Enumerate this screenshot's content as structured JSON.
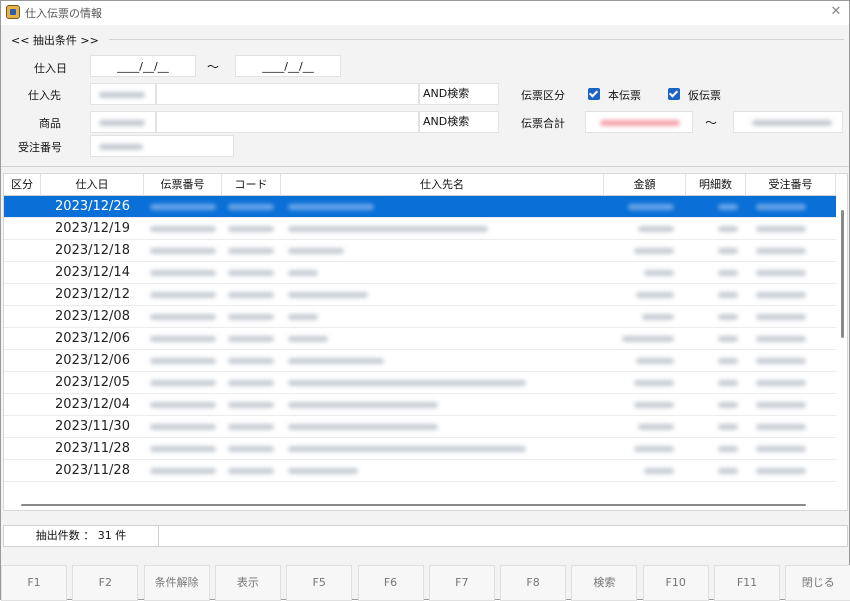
{
  "window": {
    "title": "仕入伝票の情報"
  },
  "conditions": {
    "header": "<< 抽出条件 >>",
    "date_label": "仕入日",
    "date_from": "____/__/__",
    "date_tilde": "～",
    "date_to": "____/__/__",
    "supplier_label": "仕入先",
    "supplier_and": "AND検索",
    "product_label": "商品",
    "product_and": "AND検索",
    "order_label": "受注番号",
    "slip_type_label": "伝票区分",
    "slip_main": "本伝票",
    "slip_temp": "仮伝票",
    "total_label": "伝票合計",
    "total_tilde": "～"
  },
  "grid": {
    "columns": [
      "区分",
      "仕入日",
      "伝票番号",
      "コード",
      "仕入先名",
      "金額",
      "明細数",
      "受注番号"
    ],
    "rows": [
      {
        "date": "2023/12/26"
      },
      {
        "date": "2023/12/19"
      },
      {
        "date": "2023/12/18"
      },
      {
        "date": "2023/12/14"
      },
      {
        "date": "2023/12/12"
      },
      {
        "date": "2023/12/08"
      },
      {
        "date": "2023/12/06"
      },
      {
        "date": "2023/12/06"
      },
      {
        "date": "2023/12/05"
      },
      {
        "date": "2023/12/04"
      },
      {
        "date": "2023/11/30"
      },
      {
        "date": "2023/11/28"
      },
      {
        "date": "2023/11/28"
      }
    ],
    "selected_index": 0
  },
  "status": {
    "count_text": "抽出件数 ： 31 件"
  },
  "fkeys": [
    "F1",
    "F2",
    "条件解除",
    "表示",
    "F5",
    "F6",
    "F7",
    "F8",
    "検索",
    "F10",
    "F11",
    "閉じる"
  ],
  "colors": {
    "selection": "#0a6fd6",
    "checkbox": "#1a64c8"
  }
}
